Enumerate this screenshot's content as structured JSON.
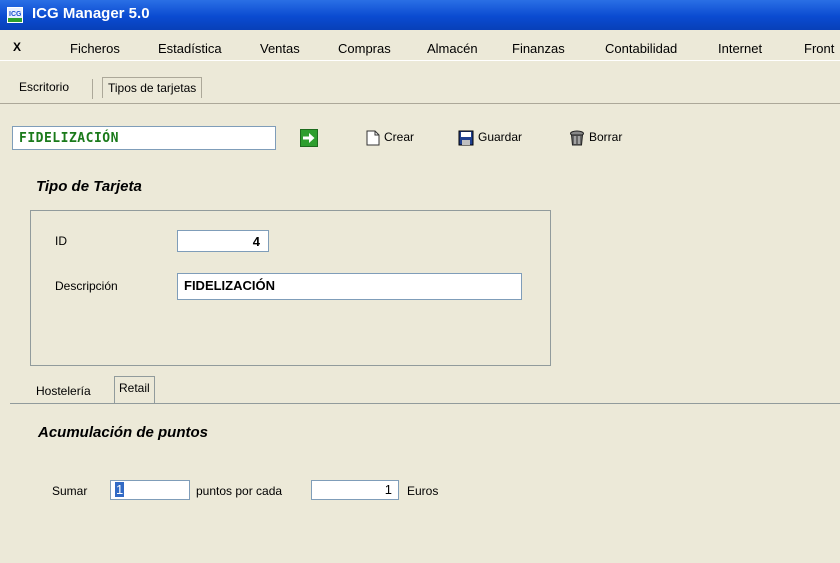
{
  "window": {
    "title": "ICG Manager 5.0",
    "app_icon": "icg-app-icon"
  },
  "menu": {
    "close_glyph": "X",
    "items": [
      "Ficheros",
      "Estadística",
      "Ventas",
      "Compras",
      "Almacén",
      "Finanzas",
      "Contabilidad",
      "Internet",
      "Front"
    ]
  },
  "doc_tabs": {
    "items": [
      "Escritorio",
      "Tipos de tarjetas"
    ],
    "active_index": 1
  },
  "toolbar": {
    "search_value": "FIDELIZACIÓN",
    "go_icon": "green-arrow-right-icon",
    "crear_label": "Crear",
    "guardar_label": "Guardar",
    "borrar_label": "Borrar"
  },
  "form": {
    "section_title": "Tipo de Tarjeta",
    "id_label": "ID",
    "id_value": "4",
    "descripcion_label": "Descripción",
    "descripcion_value": "FIDELIZACIÓN"
  },
  "subtabs": {
    "items": [
      "Hostelería",
      "Retail"
    ],
    "active_index": 1
  },
  "retail": {
    "section_title": "Acumulación de puntos",
    "sumar_label": "Sumar",
    "sumar_value": "1",
    "puntos_label": "puntos por cada",
    "euros_value": "1",
    "euros_label": "Euros"
  },
  "colors": {
    "titlebar": "#0a4bd1",
    "background": "#ece9d8",
    "search_text": "#1a7a1a"
  }
}
